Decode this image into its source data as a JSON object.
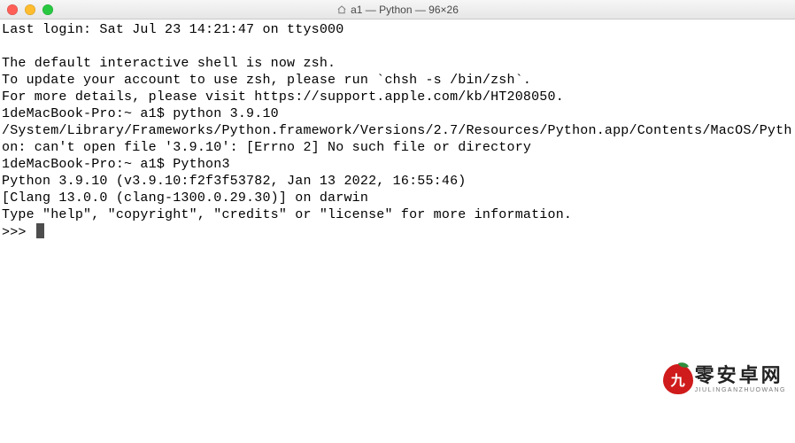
{
  "window": {
    "title": "a1 — Python — 96×26"
  },
  "colors": {
    "close": "#ff5f57",
    "minimize": "#febc2e",
    "zoom": "#28c840"
  },
  "terminal": {
    "lines": [
      "Last login: Sat Jul 23 14:21:47 on ttys000",
      "",
      "The default interactive shell is now zsh.",
      "To update your account to use zsh, please run `chsh -s /bin/zsh`.",
      "For more details, please visit https://support.apple.com/kb/HT208050.",
      "1deMacBook-Pro:~ a1$ python 3.9.10",
      "/System/Library/Frameworks/Python.framework/Versions/2.7/Resources/Python.app/Contents/MacOS/Python: can't open file '3.9.10': [Errno 2] No such file or directory",
      "1deMacBook-Pro:~ a1$ Python3",
      "Python 3.9.10 (v3.9.10:f2f3f53782, Jan 13 2022, 16:55:46)",
      "[Clang 13.0.0 (clang-1300.0.29.30)] on darwin",
      "Type \"help\", \"copyright\", \"credits\" or \"license\" for more information."
    ],
    "prompt": ">>> "
  },
  "watermark": {
    "glyph": "九",
    "main": "零安卓网",
    "sub": "JIULINGANZHUOWANG"
  }
}
